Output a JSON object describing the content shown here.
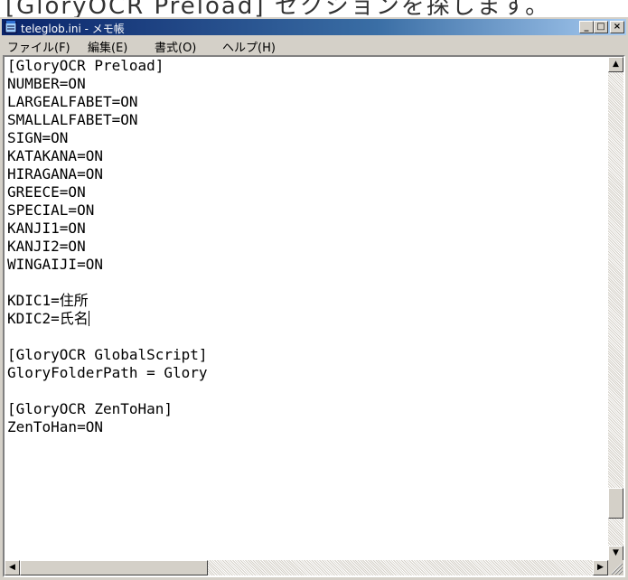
{
  "caption": "[GloryOCR Preload] セクションを探します。",
  "window": {
    "title": "teleglob.ini - メモ帳"
  },
  "title_buttons": {
    "minimize": "_",
    "maximize": "□",
    "close": "×"
  },
  "menu": [
    {
      "label": "ファイル(F)"
    },
    {
      "label": "編集(E)"
    },
    {
      "label": "書式(O)"
    },
    {
      "label": "ヘルプ(H)"
    }
  ],
  "editor": {
    "lines": [
      "[GloryOCR Preload]",
      "NUMBER=ON",
      "LARGEALFABET=ON",
      "SMALLALFABET=ON",
      "SIGN=ON",
      "KATAKANA=ON",
      "HIRAGANA=ON",
      "GREECE=ON",
      "SPECIAL=ON",
      "KANJI1=ON",
      "KANJI2=ON",
      "WINGAIJI=ON",
      "",
      "KDIC1=住所",
      "KDIC2=氏名",
      "",
      "[GloryOCR GlobalScript]",
      "GloryFolderPath = Glory",
      "",
      "[GloryOCR ZenToHan]",
      "ZenToHan=ON"
    ]
  },
  "scroll_arrows": {
    "up": "▲",
    "down": "▼",
    "left": "◀",
    "right": "▶"
  },
  "icons": {
    "app": "notepad-icon"
  }
}
